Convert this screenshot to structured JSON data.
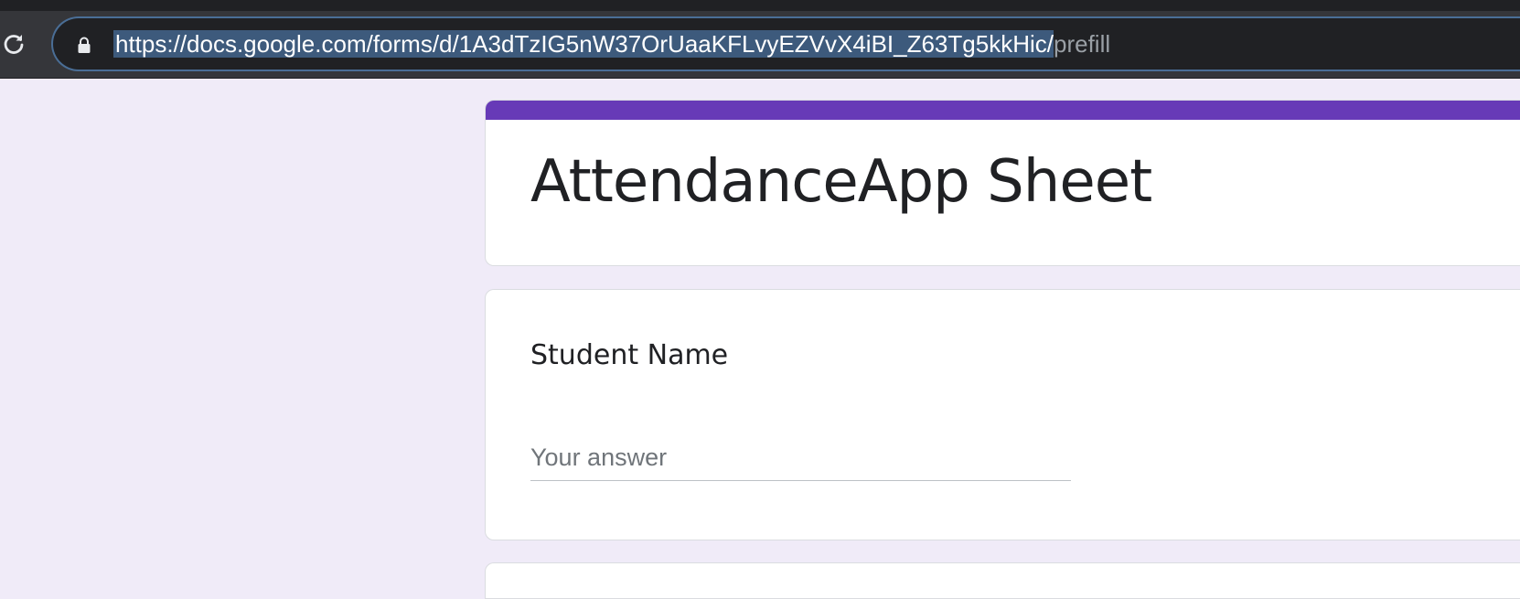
{
  "browser": {
    "url_selected": "https://docs.google.com/forms/d/1A3dTzIG5nW37OrUaaKFLvyEZVvX4iBI_Z63Tg5kkHic/",
    "url_rest": "prefill",
    "reload_icon": "reload-icon",
    "lock_icon": "lock-icon"
  },
  "form": {
    "title": "AttendanceApp Sheet",
    "accent_color": "#673ab7",
    "questions": [
      {
        "label": "Student Name",
        "placeholder": "Your answer",
        "value": ""
      }
    ]
  }
}
